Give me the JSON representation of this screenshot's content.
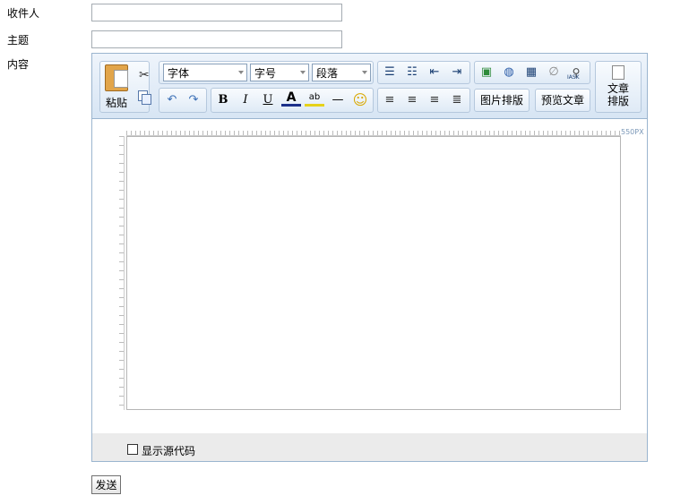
{
  "form": {
    "recipient_label": "收件人",
    "recipient_value": "",
    "subject_label": "主题",
    "subject_value": "",
    "content_label": "内容",
    "send_label": "发送"
  },
  "editor": {
    "paste_label": "粘贴",
    "font_select": "字体",
    "size_select": "字号",
    "para_select": "段落",
    "bold": "B",
    "italic": "I",
    "underline": "U",
    "font_color": "A",
    "highlight": "ab",
    "hr": "—",
    "image_layout": "图片排版",
    "preview": "预览文章",
    "article_layout_1": "文章",
    "article_layout_2": "排版",
    "ruler_label": "550PX",
    "show_source": "显示源代码",
    "iask": "IASK"
  }
}
